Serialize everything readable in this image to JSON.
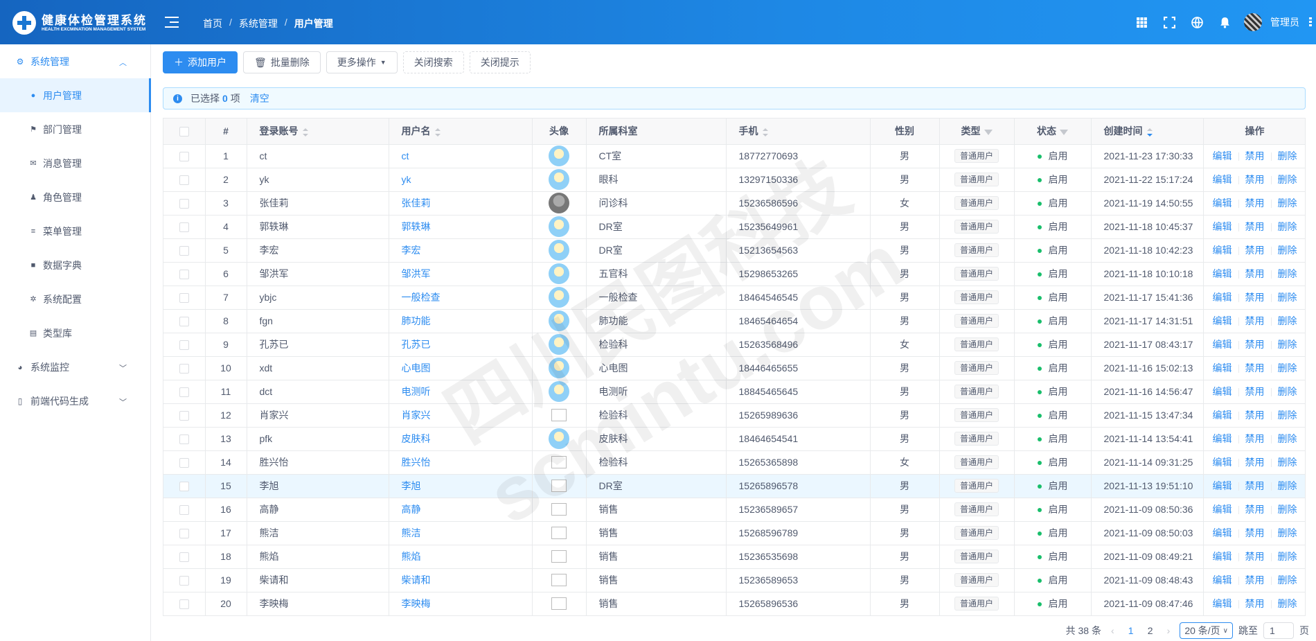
{
  "brand": {
    "title": "健康体检管理系统",
    "subtitle": "HEALTH EXCMINATION MANAGEMENT SYSTEM"
  },
  "breadcrumb": [
    "首页",
    "系统管理",
    "用户管理"
  ],
  "header": {
    "username": "管理员"
  },
  "sidebar": {
    "groups": [
      {
        "label": "系统管理",
        "icon": "gear-icon",
        "open": true
      },
      {
        "label": "系统监控",
        "icon": "dashboard-icon"
      },
      {
        "label": "前端代码生成",
        "icon": "book-icon"
      }
    ],
    "items": [
      {
        "label": "用户管理",
        "icon": "user-icon"
      },
      {
        "label": "部门管理",
        "icon": "flag-icon"
      },
      {
        "label": "消息管理",
        "icon": "mail-icon"
      },
      {
        "label": "角色管理",
        "icon": "people-icon"
      },
      {
        "label": "菜单管理",
        "icon": "menu-icon"
      },
      {
        "label": "数据字典",
        "icon": "dictionary-icon"
      },
      {
        "label": "系统配置",
        "icon": "settings-icon"
      },
      {
        "label": "类型库",
        "icon": "archive-icon"
      }
    ]
  },
  "toolbar": {
    "add": "添加用户",
    "batch_delete": "批量删除",
    "more": "更多操作",
    "close_search": "关闭搜索",
    "close_tip": "关闭提示"
  },
  "alert": {
    "selected_prefix": "已选择",
    "count": "0",
    "selected_suffix": "项",
    "clear": "清空"
  },
  "table": {
    "columns": [
      "#",
      "登录账号",
      "用户名",
      "头像",
      "所属科室",
      "手机",
      "性别",
      "类型",
      "状态",
      "创建时间",
      "操作"
    ],
    "type_tag": "普通用户",
    "status_text": "启用",
    "ops": [
      "编辑",
      "禁用",
      "删除"
    ],
    "rows": [
      {
        "no": "1",
        "account": "ct",
        "name": "ct",
        "avatar": "user",
        "dept": "CT室",
        "phone": "18772770693",
        "sex": "男",
        "created": "2021-11-23 17:30:33"
      },
      {
        "no": "2",
        "account": "yk",
        "name": "yk",
        "avatar": "user",
        "dept": "眼科",
        "phone": "13297150336",
        "sex": "男",
        "created": "2021-11-22 15:17:24"
      },
      {
        "no": "3",
        "account": "张佳莉",
        "name": "张佳莉",
        "avatar": "photo",
        "dept": "问诊科",
        "phone": "15236586596",
        "sex": "女",
        "created": "2021-11-19 14:50:55"
      },
      {
        "no": "4",
        "account": "郭轶琳",
        "name": "郭轶琳",
        "avatar": "user",
        "dept": "DR室",
        "phone": "15235649961",
        "sex": "男",
        "created": "2021-11-18 10:45:37"
      },
      {
        "no": "5",
        "account": "李宏",
        "name": "李宏",
        "avatar": "user",
        "dept": "DR室",
        "phone": "15213654563",
        "sex": "男",
        "created": "2021-11-18 10:42:23"
      },
      {
        "no": "6",
        "account": "邹洪军",
        "name": "邹洪军",
        "avatar": "user",
        "dept": "五官科",
        "phone": "15298653265",
        "sex": "男",
        "created": "2021-11-18 10:10:18"
      },
      {
        "no": "7",
        "account": "ybjc",
        "name": "一般检查",
        "avatar": "user",
        "dept": "一般检查",
        "phone": "18464546545",
        "sex": "男",
        "created": "2021-11-17 15:41:36"
      },
      {
        "no": "8",
        "account": "fgn",
        "name": "肺功能",
        "avatar": "user",
        "dept": "肺功能",
        "phone": "18465464654",
        "sex": "男",
        "created": "2021-11-17 14:31:51"
      },
      {
        "no": "9",
        "account": "孔苏已",
        "name": "孔苏已",
        "avatar": "user",
        "dept": "检验科",
        "phone": "15263568496",
        "sex": "女",
        "created": "2021-11-17 08:43:17"
      },
      {
        "no": "10",
        "account": "xdt",
        "name": "心电图",
        "avatar": "user",
        "dept": "心电图",
        "phone": "18446465655",
        "sex": "男",
        "created": "2021-11-16 15:02:13"
      },
      {
        "no": "11",
        "account": "dct",
        "name": "电测听",
        "avatar": "user",
        "dept": "电测听",
        "phone": "18845465645",
        "sex": "男",
        "created": "2021-11-16 14:56:47"
      },
      {
        "no": "12",
        "account": "肖家兴",
        "name": "肖家兴",
        "avatar": "broken",
        "dept": "检验科",
        "phone": "15265989636",
        "sex": "男",
        "created": "2021-11-15 13:47:34"
      },
      {
        "no": "13",
        "account": "pfk",
        "name": "皮肤科",
        "avatar": "user",
        "dept": "皮肤科",
        "phone": "18464654541",
        "sex": "男",
        "created": "2021-11-14 13:54:41"
      },
      {
        "no": "14",
        "account": "胜兴怡",
        "name": "胜兴怡",
        "avatar": "broken",
        "dept": "检验科",
        "phone": "15265365898",
        "sex": "女",
        "created": "2021-11-14 09:31:25"
      },
      {
        "no": "15",
        "account": "李旭",
        "name": "李旭",
        "avatar": "broken",
        "dept": "DR室",
        "phone": "15265896578",
        "sex": "男",
        "created": "2021-11-13 19:51:10",
        "hl": true
      },
      {
        "no": "16",
        "account": "高静",
        "name": "高静",
        "avatar": "broken",
        "dept": "销售",
        "phone": "15236589657",
        "sex": "男",
        "created": "2021-11-09 08:50:36"
      },
      {
        "no": "17",
        "account": "熊洁",
        "name": "熊洁",
        "avatar": "broken",
        "dept": "销售",
        "phone": "15268596789",
        "sex": "男",
        "created": "2021-11-09 08:50:03"
      },
      {
        "no": "18",
        "account": "熊焰",
        "name": "熊焰",
        "avatar": "broken",
        "dept": "销售",
        "phone": "15236535698",
        "sex": "男",
        "created": "2021-11-09 08:49:21"
      },
      {
        "no": "19",
        "account": "柴请和",
        "name": "柴请和",
        "avatar": "broken",
        "dept": "销售",
        "phone": "15236589653",
        "sex": "男",
        "created": "2021-11-09 08:48:43"
      },
      {
        "no": "20",
        "account": "李映梅",
        "name": "李映梅",
        "avatar": "broken",
        "dept": "销售",
        "phone": "15265896536",
        "sex": "男",
        "created": "2021-11-09 08:47:46"
      }
    ]
  },
  "pager": {
    "total": "共 38 条",
    "pages": [
      "1",
      "2"
    ],
    "current": "1",
    "size": "20 条/页",
    "goto": "跳至",
    "goto_value": "1",
    "page_unit": "页"
  },
  "watermark": "四川民图科技 scmintu.com",
  "colors": {
    "primary": "#2d8cf0",
    "header": "#1e88e5",
    "success": "#19be6b"
  }
}
